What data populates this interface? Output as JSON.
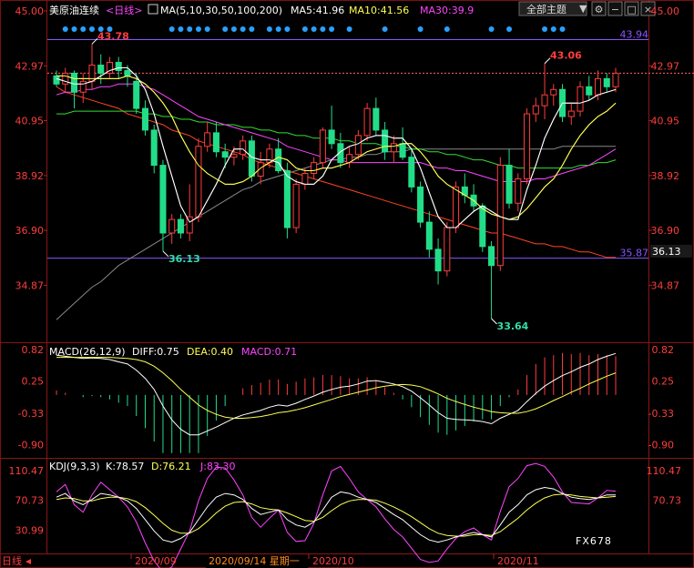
{
  "title": {
    "symbol": "美原油连续",
    "period": "<日线>",
    "ma_label": "MA(5,10,30,50,100,200)",
    "ma5": "MA5:41.96",
    "ma10": "MA10:41.56",
    "ma30": "MA30:39.9"
  },
  "toolbar": {
    "theme_button": "全部主题",
    "theme_arrow": "▼"
  },
  "macd_header": {
    "name": "MACD(26,12,9)",
    "diff": "DIFF:0.75",
    "dea": "DEA:0.40",
    "macd": "MACD:0.71"
  },
  "kdj_header": {
    "name": "KDJ(9,3,3)",
    "k": "K:78.57",
    "d": "D:76.21",
    "j": "J:83.30"
  },
  "xaxis": {
    "labels": [
      "2020/09",
      "2020/10",
      "2020/11"
    ],
    "cursor_date": "2020/09/14 星期一",
    "left_marker": "日线"
  },
  "watermark": "FX678",
  "colors": {
    "up": "#ff3d3d",
    "down": "#22dd88",
    "ma5": "#ffffff",
    "ma10": "#ffff55",
    "ma30": "#ff44ff",
    "ma50": "#33dd33",
    "ma100": "#888888",
    "ma200": "#ff4422",
    "hline": "#8855ff",
    "dots": "#2aa0ff"
  },
  "chart_data": [
    {
      "type": "candlestick",
      "y_ticks_left": [
        "45.00",
        "42.97",
        "40.95",
        "38.92",
        "36.90",
        "34.87"
      ],
      "y_ticks_right": [
        "45.00",
        "42.97",
        "40.95",
        "38.92",
        "36.90",
        "34.87"
      ],
      "ylim": [
        32.8,
        45.0
      ],
      "current_price": "36.13",
      "hlines": [
        {
          "value": 43.94,
          "label": "43.94"
        },
        {
          "value": 35.87,
          "label": "35.87"
        }
      ],
      "annotations": [
        {
          "text": "43.78",
          "index": 4,
          "value": 43.78,
          "where": "high"
        },
        {
          "text": "36.13",
          "index": 12,
          "value": 36.13,
          "where": "low"
        },
        {
          "text": "33.64",
          "index": 49,
          "value": 33.64,
          "where": "low"
        },
        {
          "text": "43.06",
          "index": 55,
          "value": 43.06,
          "where": "high"
        }
      ],
      "candles": [
        [
          42.6,
          42.8,
          42.2,
          42.3
        ],
        [
          42.3,
          42.9,
          42.0,
          42.7
        ],
        [
          42.7,
          42.8,
          41.4,
          42.0
        ],
        [
          42.0,
          42.7,
          41.6,
          42.4
        ],
        [
          42.4,
          43.78,
          42.1,
          43.0
        ],
        [
          43.0,
          43.4,
          42.3,
          42.7
        ],
        [
          42.7,
          43.3,
          42.5,
          43.1
        ],
        [
          43.1,
          43.3,
          42.5,
          42.8
        ],
        [
          42.8,
          43.0,
          42.2,
          42.6
        ],
        [
          42.4,
          42.7,
          41.2,
          41.4
        ],
        [
          41.4,
          41.7,
          40.4,
          40.6
        ],
        [
          40.6,
          40.8,
          39.0,
          39.3
        ],
        [
          39.3,
          39.5,
          36.13,
          36.8
        ],
        [
          36.8,
          37.5,
          36.4,
          37.3
        ],
        [
          37.3,
          37.5,
          36.6,
          36.8
        ],
        [
          36.8,
          38.6,
          36.5,
          37.4
        ],
        [
          37.4,
          40.3,
          37.2,
          40.0
        ],
        [
          40.0,
          40.9,
          39.8,
          40.5
        ],
        [
          40.5,
          40.9,
          39.6,
          39.8
        ],
        [
          39.8,
          40.1,
          39.2,
          39.6
        ],
        [
          39.6,
          40.0,
          39.3,
          39.7
        ],
        [
          39.7,
          40.4,
          39.5,
          40.2
        ],
        [
          40.2,
          40.4,
          38.7,
          38.9
        ],
        [
          38.9,
          39.8,
          38.6,
          39.4
        ],
        [
          39.4,
          40.1,
          39.2,
          39.9
        ],
        [
          39.9,
          40.3,
          39.0,
          39.1
        ],
        [
          39.1,
          39.4,
          36.6,
          37.0
        ],
        [
          37.0,
          38.8,
          36.8,
          38.6
        ],
        [
          38.6,
          39.2,
          38.4,
          39.0
        ],
        [
          39.0,
          39.6,
          38.8,
          39.4
        ],
        [
          39.4,
          40.7,
          39.2,
          40.6
        ],
        [
          40.6,
          41.5,
          39.9,
          40.1
        ],
        [
          40.1,
          40.5,
          39.2,
          39.4
        ],
        [
          39.4,
          40.0,
          39.2,
          39.7
        ],
        [
          39.7,
          40.6,
          39.5,
          40.4
        ],
        [
          40.4,
          41.6,
          40.2,
          41.4
        ],
        [
          41.4,
          41.8,
          40.4,
          40.6
        ],
        [
          40.6,
          40.9,
          39.5,
          39.8
        ],
        [
          39.8,
          40.4,
          39.4,
          40.1
        ],
        [
          40.1,
          40.7,
          39.5,
          39.6
        ],
        [
          39.6,
          39.9,
          38.3,
          38.5
        ],
        [
          38.5,
          38.7,
          37.0,
          37.2
        ],
        [
          37.2,
          37.6,
          35.9,
          36.2
        ],
        [
          36.2,
          36.6,
          34.9,
          35.4
        ],
        [
          35.4,
          37.2,
          35.2,
          37.0
        ],
        [
          37.0,
          38.7,
          36.8,
          38.5
        ],
        [
          38.5,
          39.0,
          37.9,
          38.2
        ],
        [
          38.2,
          38.6,
          37.6,
          37.8
        ],
        [
          37.8,
          37.9,
          36.1,
          36.3
        ],
        [
          36.3,
          36.5,
          33.64,
          35.6
        ],
        [
          35.6,
          39.6,
          35.4,
          39.3
        ],
        [
          39.3,
          39.9,
          37.7,
          37.9
        ],
        [
          37.9,
          39.0,
          37.6,
          38.8
        ],
        [
          38.8,
          41.4,
          38.6,
          41.2
        ],
        [
          41.2,
          41.8,
          40.9,
          41.5
        ],
        [
          41.5,
          43.06,
          41.0,
          41.9
        ],
        [
          41.9,
          42.3,
          41.5,
          42.1
        ],
        [
          42.1,
          42.3,
          40.9,
          41.1
        ],
        [
          41.1,
          41.6,
          40.8,
          41.3
        ],
        [
          41.3,
          42.4,
          41.1,
          42.2
        ],
        [
          42.2,
          42.6,
          41.7,
          41.9
        ],
        [
          41.9,
          42.8,
          41.7,
          42.5
        ],
        [
          42.5,
          42.7,
          42.0,
          42.2
        ],
        [
          42.2,
          42.9,
          42.0,
          42.7
        ]
      ],
      "ma_lines": {
        "ma5": [
          42.5,
          42.4,
          42.3,
          42.3,
          42.4,
          42.6,
          42.8,
          42.9,
          42.9,
          42.6,
          42.1,
          41.2,
          40.0,
          38.9,
          37.8,
          37.2,
          37.4,
          38.0,
          38.6,
          39.3,
          39.9,
          39.9,
          39.6,
          39.5,
          39.5,
          39.4,
          38.9,
          38.7,
          38.6,
          38.6,
          38.9,
          39.5,
          39.8,
          40.0,
          40.1,
          40.3,
          40.4,
          40.4,
          40.3,
          40.3,
          39.9,
          39.2,
          38.3,
          37.4,
          37.0,
          37.0,
          37.3,
          37.6,
          37.8,
          37.6,
          37.4,
          37.3,
          37.3,
          38.4,
          39.3,
          40.3,
          41.0,
          41.6,
          41.6,
          41.6,
          41.7,
          41.9,
          42.0,
          42.1
        ],
        "ma10": [
          42.6,
          42.6,
          42.5,
          42.5,
          42.5,
          42.5,
          42.5,
          42.5,
          42.6,
          42.5,
          42.3,
          42.0,
          41.6,
          41.1,
          40.4,
          39.8,
          39.3,
          39.0,
          38.8,
          38.6,
          38.6,
          38.7,
          38.9,
          39.2,
          39.4,
          39.6,
          39.5,
          39.2,
          39.1,
          39.1,
          39.2,
          39.2,
          39.3,
          39.4,
          39.6,
          39.8,
          39.9,
          40.0,
          40.0,
          40.1,
          40.1,
          39.8,
          39.4,
          38.9,
          38.6,
          38.4,
          38.2,
          38.0,
          37.7,
          37.5,
          37.4,
          37.3,
          37.4,
          37.7,
          38.1,
          38.5,
          38.8,
          39.3,
          39.9,
          40.4,
          40.8,
          41.1,
          41.3,
          41.6
        ],
        "ma30": [
          41.9,
          42.0,
          42.0,
          42.1,
          42.1,
          42.2,
          42.2,
          42.3,
          42.3,
          42.3,
          42.2,
          42.1,
          41.9,
          41.7,
          41.5,
          41.3,
          41.1,
          41.0,
          40.9,
          40.8,
          40.7,
          40.6,
          40.5,
          40.4,
          40.3,
          40.2,
          40.0,
          39.9,
          39.8,
          39.7,
          39.6,
          39.5,
          39.5,
          39.4,
          39.4,
          39.4,
          39.4,
          39.4,
          39.4,
          39.4,
          39.4,
          39.4,
          39.3,
          39.2,
          39.2,
          39.1,
          39.1,
          39.0,
          38.9,
          38.8,
          38.7,
          38.7,
          38.7,
          38.7,
          38.8,
          38.8,
          38.9,
          39.0,
          39.1,
          39.2,
          39.3,
          39.5,
          39.7,
          39.9
        ],
        "ma50": [
          41.2,
          41.2,
          41.3,
          41.3,
          41.3,
          41.3,
          41.3,
          41.3,
          41.3,
          41.3,
          41.2,
          41.2,
          41.1,
          41.1,
          41.0,
          41.0,
          40.9,
          40.9,
          40.8,
          40.8,
          40.8,
          40.7,
          40.7,
          40.6,
          40.6,
          40.5,
          40.5,
          40.4,
          40.4,
          40.3,
          40.3,
          40.3,
          40.2,
          40.2,
          40.1,
          40.1,
          40.1,
          40.0,
          40.0,
          40.0,
          39.9,
          39.9,
          39.8,
          39.8,
          39.7,
          39.7,
          39.6,
          39.5,
          39.5,
          39.4,
          39.3,
          39.3,
          39.2,
          39.2,
          39.2,
          39.2,
          39.2,
          39.2,
          39.2,
          39.3,
          39.3,
          39.4,
          39.4,
          39.5
        ],
        "ma100": [
          33.6,
          33.9,
          34.2,
          34.5,
          34.8,
          35.0,
          35.3,
          35.6,
          35.8,
          36.0,
          36.2,
          36.4,
          36.6,
          36.8,
          37.0,
          37.2,
          37.4,
          37.6,
          37.8,
          38.0,
          38.2,
          38.4,
          38.5,
          38.7,
          38.8,
          38.9,
          39.0,
          39.1,
          39.2,
          39.3,
          39.4,
          39.5,
          39.5,
          39.6,
          39.6,
          39.7,
          39.7,
          39.8,
          39.8,
          39.8,
          39.9,
          39.9,
          39.9,
          39.9,
          39.9,
          39.9,
          39.9,
          39.9,
          39.9,
          39.9,
          39.9,
          39.9,
          39.9,
          39.9,
          39.9,
          39.9,
          39.9,
          40.0,
          40.0,
          40.0,
          40.0,
          40.0,
          40.0,
          40.0
        ],
        "ma200": [
          42.2,
          42.0,
          41.9,
          41.8,
          41.7,
          41.6,
          41.5,
          41.4,
          41.2,
          41.1,
          41.0,
          40.9,
          40.8,
          40.6,
          40.5,
          40.4,
          40.2,
          40.1,
          40.0,
          39.9,
          39.8,
          39.7,
          39.5,
          39.4,
          39.3,
          39.2,
          39.1,
          39.0,
          38.9,
          38.8,
          38.7,
          38.6,
          38.5,
          38.4,
          38.3,
          38.2,
          38.1,
          38.0,
          37.9,
          37.8,
          37.7,
          37.6,
          37.5,
          37.4,
          37.3,
          37.2,
          37.1,
          37.0,
          36.9,
          36.8,
          36.8,
          36.7,
          36.6,
          36.5,
          36.4,
          36.4,
          36.3,
          36.3,
          36.2,
          36.1,
          36.1,
          36.0,
          35.9,
          35.9
        ]
      }
    },
    {
      "type": "macd",
      "y_ticks_left": [
        "0.82",
        "0.25",
        "-0.33",
        "-0.90"
      ],
      "y_ticks_right": [
        "0.82",
        "0.25",
        "-0.33",
        "-0.90"
      ],
      "ylim": [
        -1.12,
        0.92
      ],
      "diff": [
        0.72,
        0.7,
        0.68,
        0.66,
        0.67,
        0.66,
        0.64,
        0.6,
        0.56,
        0.45,
        0.3,
        0.1,
        -0.2,
        -0.45,
        -0.62,
        -0.72,
        -0.72,
        -0.65,
        -0.58,
        -0.5,
        -0.42,
        -0.36,
        -0.32,
        -0.28,
        -0.22,
        -0.18,
        -0.2,
        -0.15,
        -0.08,
        -0.02,
        0.05,
        0.1,
        0.14,
        0.16,
        0.2,
        0.25,
        0.26,
        0.23,
        0.2,
        0.15,
        0.07,
        -0.05,
        -0.18,
        -0.32,
        -0.42,
        -0.44,
        -0.45,
        -0.46,
        -0.48,
        -0.52,
        -0.42,
        -0.35,
        -0.28,
        -0.12,
        0.03,
        0.16,
        0.26,
        0.35,
        0.42,
        0.5,
        0.56,
        0.64,
        0.7,
        0.75
      ],
      "dea": [
        0.68,
        0.68,
        0.68,
        0.68,
        0.68,
        0.68,
        0.68,
        0.67,
        0.66,
        0.64,
        0.6,
        0.52,
        0.4,
        0.26,
        0.1,
        -0.04,
        -0.18,
        -0.28,
        -0.35,
        -0.4,
        -0.42,
        -0.42,
        -0.41,
        -0.39,
        -0.36,
        -0.32,
        -0.3,
        -0.27,
        -0.23,
        -0.18,
        -0.13,
        -0.08,
        -0.03,
        0.01,
        0.05,
        0.09,
        0.13,
        0.16,
        0.18,
        0.19,
        0.18,
        0.15,
        0.09,
        0.02,
        -0.06,
        -0.12,
        -0.17,
        -0.22,
        -0.26,
        -0.3,
        -0.32,
        -0.33,
        -0.33,
        -0.3,
        -0.25,
        -0.18,
        -0.1,
        -0.03,
        0.05,
        0.12,
        0.2,
        0.27,
        0.34,
        0.4
      ]
    },
    {
      "type": "kdj",
      "y_ticks_left": [
        "110.47",
        "70.73",
        "30.99"
      ],
      "y_ticks_right": [
        "110.47",
        "70.73"
      ],
      "ylim": [
        0,
        125
      ],
      "k": [
        75,
        80,
        70,
        65,
        72,
        80,
        78,
        75,
        70,
        60,
        45,
        30,
        18,
        15,
        20,
        28,
        45,
        62,
        75,
        80,
        78,
        72,
        60,
        52,
        55,
        58,
        45,
        38,
        35,
        42,
        58,
        75,
        82,
        80,
        75,
        72,
        68,
        60,
        52,
        45,
        35,
        25,
        18,
        15,
        18,
        22,
        25,
        28,
        25,
        22,
        38,
        55,
        65,
        78,
        85,
        88,
        86,
        80,
        75,
        73,
        72,
        74,
        78,
        78
      ],
      "d": [
        72,
        74,
        73,
        70,
        70,
        73,
        75,
        75,
        73,
        69,
        61,
        51,
        40,
        31,
        27,
        27,
        33,
        43,
        54,
        63,
        68,
        69,
        66,
        61,
        59,
        58,
        54,
        49,
        44,
        43,
        48,
        57,
        65,
        70,
        72,
        72,
        71,
        67,
        62,
        56,
        49,
        41,
        33,
        27,
        24,
        23,
        23,
        25,
        25,
        24,
        29,
        38,
        47,
        58,
        67,
        74,
        78,
        79,
        78,
        76,
        75,
        74,
        75,
        76
      ],
      "j": [
        82,
        92,
        65,
        55,
        78,
        95,
        85,
        75,
        62,
        42,
        14,
        -10,
        -25,
        -18,
        6,
        30,
        70,
        100,
        115,
        114,
        98,
        78,
        48,
        35,
        47,
        58,
        28,
        16,
        17,
        40,
        78,
        110,
        116,
        100,
        82,
        72,
        62,
        46,
        32,
        22,
        7,
        -8,
        -12,
        -10,
        6,
        20,
        29,
        34,
        25,
        18,
        56,
        89,
        100,
        117,
        120,
        116,
        102,
        82,
        68,
        67,
        66,
        74,
        84,
        83
      ]
    }
  ]
}
